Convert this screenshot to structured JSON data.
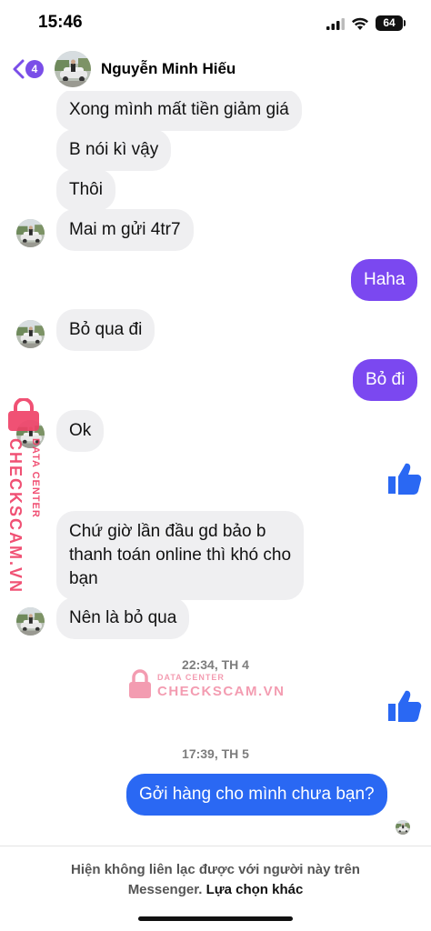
{
  "status_bar": {
    "time": "15:46",
    "battery": "64"
  },
  "header": {
    "back_badge": "4",
    "contact_name": "Nguyễn Minh Hiếu"
  },
  "messages": [
    {
      "side": "in",
      "text": "Xong mình mất tiền giảm giá"
    },
    {
      "side": "in",
      "text": "B nói kì vậy"
    },
    {
      "side": "in",
      "text": "Thôi"
    },
    {
      "side": "in",
      "text": "Mai m gửi 4tr7"
    },
    {
      "side": "out",
      "text": "Haha"
    },
    {
      "side": "in",
      "text": "Bỏ qua đi"
    },
    {
      "side": "out",
      "text": "Bỏ đi"
    },
    {
      "side": "in",
      "text": "Ok"
    },
    {
      "side": "out",
      "sticker": "thumbs-up-icon"
    },
    {
      "side": "in",
      "lines": [
        "Chứ giờ lần đầu gd bảo b",
        "thanh toán online thì khó cho",
        "bạn"
      ]
    },
    {
      "side": "in",
      "text": "Nên là bỏ qua"
    },
    {
      "side": "out",
      "sticker": "thumbs-up-icon"
    },
    {
      "side": "out",
      "text": "Gởi hàng cho mình chưa bạn?"
    }
  ],
  "timestamps": [
    "22:34, TH 4",
    "17:39, TH 5"
  ],
  "watermark": {
    "sub": "DATA CENTER",
    "main": "CHECKSCAM.VN"
  },
  "footer": {
    "notice_line1": "Hiện không liên lạc được với người này trên",
    "notice_line2": "Messenger.",
    "link": "Lựa chọn khác"
  },
  "colors": {
    "accent_purple": "#7b48f0",
    "accent_blue": "#2a68f3",
    "thumbs_up": "#2a68f3",
    "incoming_bubble": "#efeff1",
    "watermark": "#ef3f66"
  }
}
